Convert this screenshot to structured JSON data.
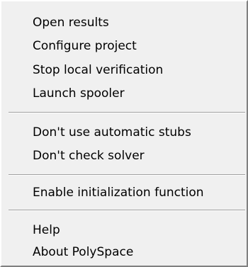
{
  "menu": {
    "groups": [
      {
        "items": [
          {
            "label": "Open results"
          },
          {
            "label": "Configure project"
          },
          {
            "label": "Stop local verification"
          },
          {
            "label": "Launch spooler"
          }
        ]
      },
      {
        "items": [
          {
            "label": "Don't use automatic stubs"
          },
          {
            "label": "Don't check solver"
          }
        ]
      },
      {
        "items": [
          {
            "label": "Enable initialization function"
          }
        ]
      },
      {
        "items": [
          {
            "label": "Help"
          },
          {
            "label": "About PolySpace"
          }
        ]
      }
    ]
  }
}
